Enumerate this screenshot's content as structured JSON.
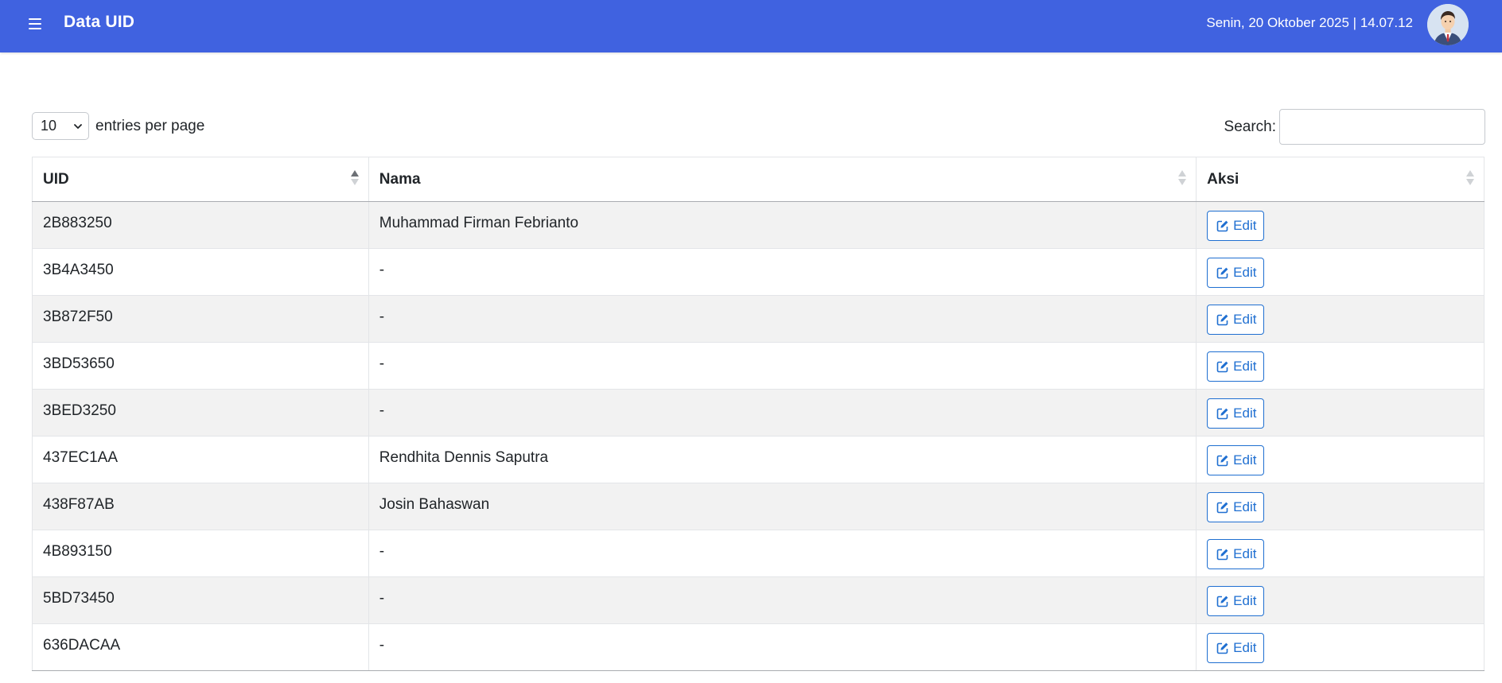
{
  "header": {
    "title": "Data UID",
    "datetime": "Senin, 20 Oktober 2025 | 14.07.12",
    "menu_icon": "hamburger-menu-icon",
    "avatar_icon": "user-avatar-icon",
    "bar_color": "#4062e0"
  },
  "controls": {
    "entries_value": "10",
    "entries_label": "entries per page",
    "search_label": "Search:",
    "search_value": ""
  },
  "table": {
    "columns": [
      "UID",
      "Nama",
      "Aksi"
    ],
    "sort_column": "UID",
    "sort_direction": "ascending",
    "edit_label": "Edit",
    "edit_icon": "pencil-square-icon",
    "rows": [
      {
        "uid": "2B883250",
        "nama": "Muhammad Firman Febrianto"
      },
      {
        "uid": "3B4A3450",
        "nama": "-"
      },
      {
        "uid": "3B872F50",
        "nama": "-"
      },
      {
        "uid": "3BD53650",
        "nama": "-"
      },
      {
        "uid": "3BED3250",
        "nama": "-"
      },
      {
        "uid": "437EC1AA",
        "nama": "Rendhita Dennis Saputra"
      },
      {
        "uid": "438F87AB",
        "nama": "Josin Bahaswan"
      },
      {
        "uid": "4B893150",
        "nama": "-"
      },
      {
        "uid": "5BD73450",
        "nama": "-"
      },
      {
        "uid": "636DACAA",
        "nama": "-"
      }
    ]
  }
}
